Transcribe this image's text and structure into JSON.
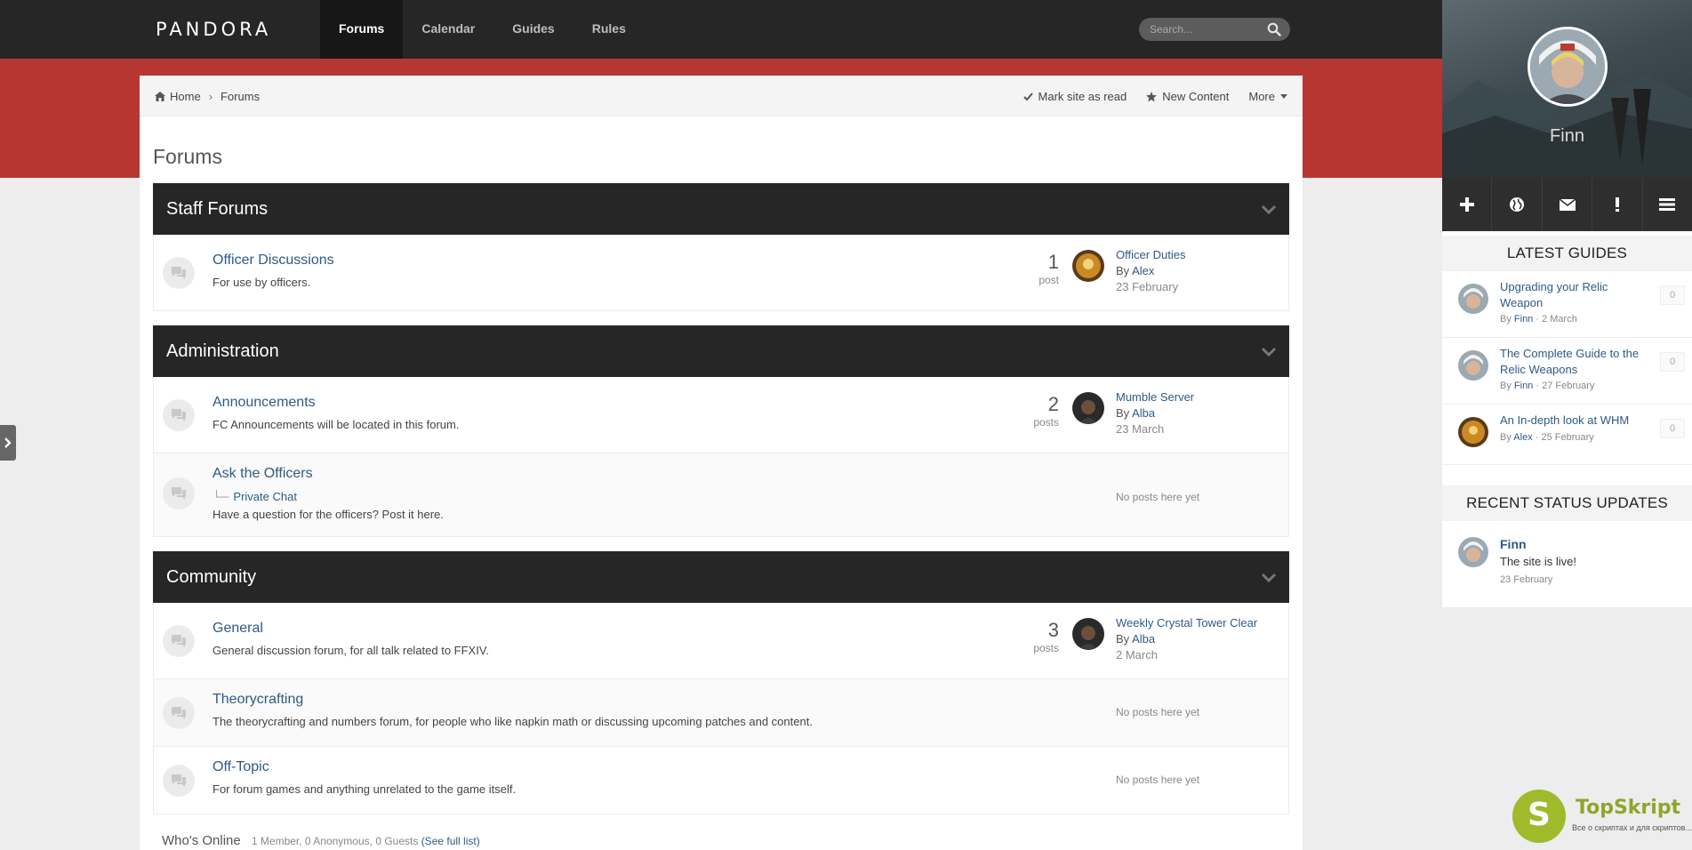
{
  "header": {
    "logo": "PANDORA",
    "nav": [
      "Forums",
      "Calendar",
      "Guides",
      "Rules"
    ],
    "active_nav": "Forums",
    "search_placeholder": "Search..."
  },
  "breadcrumb": {
    "home": "Home",
    "current": "Forums",
    "actions": {
      "mark_read": "Mark site as read",
      "new_content": "New Content",
      "more": "More"
    }
  },
  "page_title": "Forums",
  "categories": [
    {
      "name": "Staff Forums",
      "forums": [
        {
          "title": "Officer Discussions",
          "desc": "For use by officers.",
          "count": "1",
          "count_label": "post",
          "last": {
            "title": "Officer Duties",
            "by_prefix": "By",
            "by": "Alex",
            "date": "23 February"
          }
        }
      ]
    },
    {
      "name": "Administration",
      "forums": [
        {
          "title": "Announcements",
          "desc": "FC Announcements will be located in this forum.",
          "count": "2",
          "count_label": "posts",
          "last": {
            "title": "Mumble Server",
            "by_prefix": "By",
            "by": "Alba",
            "date": "23 March"
          }
        },
        {
          "title": "Ask the Officers",
          "subforum": "Private Chat",
          "desc": "Have a question for the officers? Post it here.",
          "no_posts": "No posts here yet"
        }
      ]
    },
    {
      "name": "Community",
      "forums": [
        {
          "title": "General",
          "desc": "General discussion forum, for all talk related to FFXIV.",
          "count": "3",
          "count_label": "posts",
          "last": {
            "title": "Weekly Crystal Tower Clear",
            "by_prefix": "By",
            "by": "Alba",
            "date": "2 March"
          }
        },
        {
          "title": "Theorycrafting",
          "desc": "The theorycrafting and numbers forum, for people who like napkin math or discussing upcoming patches and content.",
          "no_posts": "No posts here yet"
        },
        {
          "title": "Off-Topic",
          "desc": "For forum games and anything unrelated to the game itself.",
          "no_posts": "No posts here yet"
        }
      ]
    }
  ],
  "whos_online": {
    "title": "Who's Online",
    "meta": "1 Member, 0 Anonymous, 0 Guests",
    "link": "(See full list)"
  },
  "sidebar": {
    "user_name": "Finn",
    "latest_guides_title": "LATEST GUIDES",
    "guides": [
      {
        "title": "Upgrading your Relic Weapon",
        "by_prefix": "By",
        "author": "Finn",
        "date": "· 2 March",
        "count": "0"
      },
      {
        "title": "The Complete Guide to the Relic Weapons",
        "by_prefix": "By",
        "author": "Finn",
        "date": "· 27 February",
        "count": "0"
      },
      {
        "title": "An In-depth look at WHM",
        "by_prefix": "By",
        "author": "Alex",
        "date": "· 25 February",
        "count": "0"
      }
    ],
    "status_title": "RECENT STATUS UPDATES",
    "status": {
      "name": "Finn",
      "text": "The site is live!",
      "date": "23 February"
    }
  },
  "watermark": {
    "brand": "TopSkript",
    "tagline": "Все о скриптах и для скриптов..."
  }
}
